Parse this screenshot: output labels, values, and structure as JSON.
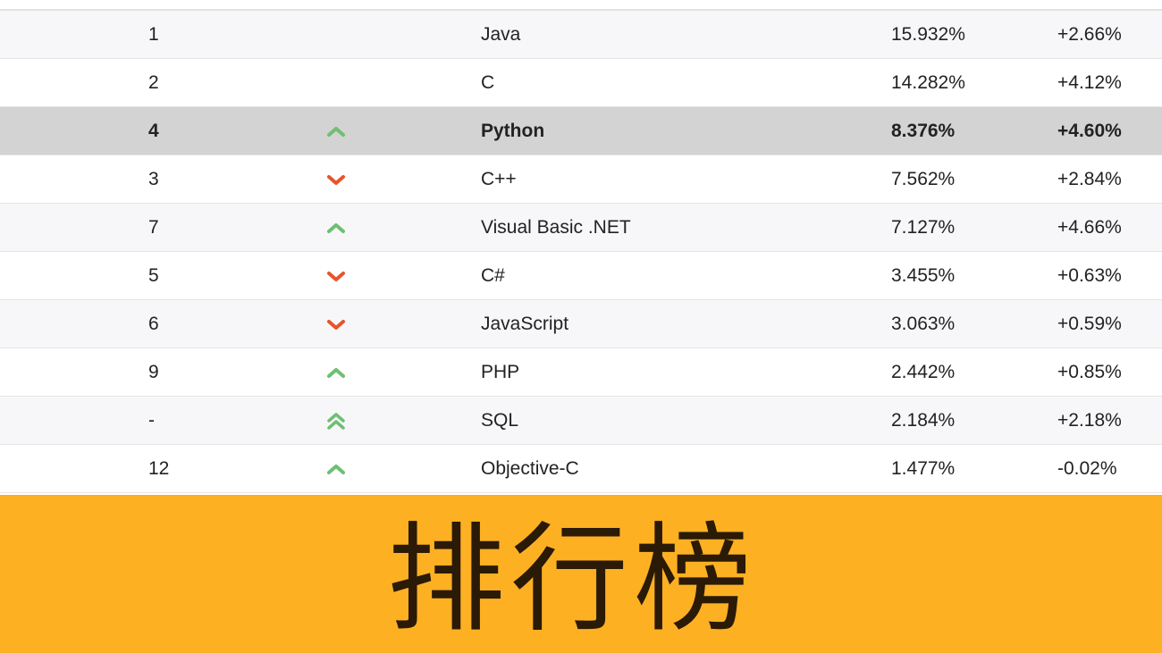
{
  "colors": {
    "up": "#6fbf73",
    "down": "#e8532a",
    "highlight_row": "#d3d3d3",
    "banner": "#fdb022"
  },
  "rows": [
    {
      "rank": "1",
      "trend": "none",
      "language": "Java",
      "rating": "15.932%",
      "change": "+2.66%"
    },
    {
      "rank": "2",
      "trend": "none",
      "language": "C",
      "rating": "14.282%",
      "change": "+4.12%"
    },
    {
      "rank": "4",
      "trend": "up-icon",
      "language": "Python",
      "rating": "8.376%",
      "change": "+4.60%"
    },
    {
      "rank": "3",
      "trend": "down-icon",
      "language": "C++",
      "rating": "7.562%",
      "change": "+2.84%"
    },
    {
      "rank": "7",
      "trend": "up-icon",
      "language": "Visual Basic .NET",
      "rating": "7.127%",
      "change": "+4.66%"
    },
    {
      "rank": "5",
      "trend": "down-icon",
      "language": "C#",
      "rating": "3.455%",
      "change": "+0.63%"
    },
    {
      "rank": "6",
      "trend": "down-icon",
      "language": "JavaScript",
      "rating": "3.063%",
      "change": "+0.59%"
    },
    {
      "rank": "9",
      "trend": "up-icon",
      "language": "PHP",
      "rating": "2.442%",
      "change": "+0.85%"
    },
    {
      "rank": "-",
      "trend": "double-up-icon",
      "language": "SQL",
      "rating": "2.184%",
      "change": "+2.18%"
    },
    {
      "rank": "12",
      "trend": "up-icon",
      "language": "Objective-C",
      "rating": "1.477%",
      "change": "-0.02%"
    }
  ],
  "banner": {
    "title": "排行榜"
  }
}
